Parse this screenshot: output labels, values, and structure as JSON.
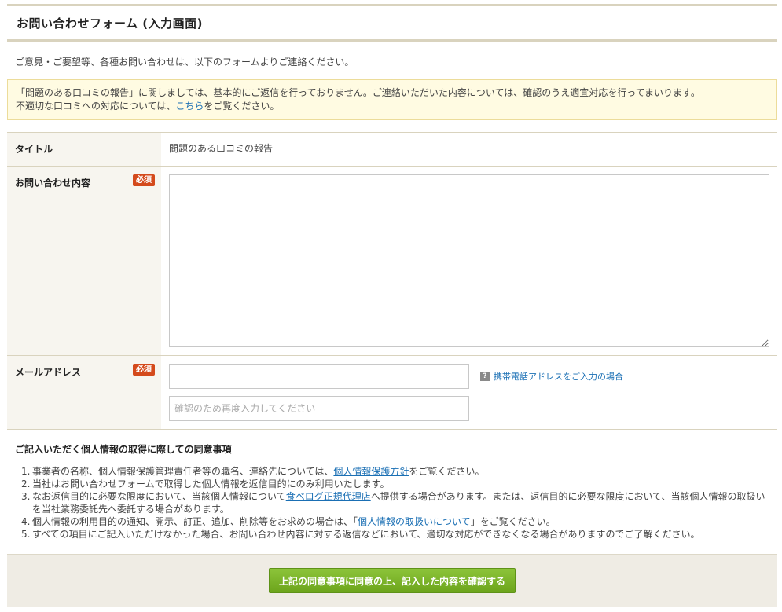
{
  "header": {
    "title": "お問い合わせフォーム (入力画面)"
  },
  "intro": "ご意見・ご要望等、各種お問い合わせは、以下のフォームよりご連絡ください。",
  "notice": {
    "line1": "「問題のある口コミの報告」に関しましては、基本的にご返信を行っておりません。ご連絡いただいた内容については、確認のうえ適宜対応を行ってまいります。",
    "line2_before": "不適切な口コミへの対応については、",
    "line2_link": "こちら",
    "line2_after": "をご覧ください。"
  },
  "form": {
    "required_badge": "必須",
    "title_label": "タイトル",
    "title_value": "問題のある口コミの報告",
    "content_label": "お問い合わせ内容",
    "content_value": "",
    "email_label": "メールアドレス",
    "email_value": "",
    "email_confirm_placeholder": "確認のため再度入力してください",
    "mobile_help_link": "携帯電話アドレスをご入力の場合"
  },
  "consent": {
    "heading": "ご記入いただく個人情報の取得に際しての同意事項",
    "items": [
      {
        "num": "1.",
        "before": "事業者の名称、個人情報保護管理責任者等の職名、連絡先については、",
        "link": "個人情報保護方針",
        "after": "をご覧ください。"
      },
      {
        "num": "2.",
        "text": "当社はお問い合わせフォームで取得した個人情報を返信目的にのみ利用いたします。"
      },
      {
        "num": "3.",
        "before": "なお返信目的に必要な限度において、当該個人情報について",
        "link": "食べログ正規代理店",
        "after": "へ提供する場合があります。または、返信目的に必要な限度において、当該個人情報の取扱いを当社業務委託先へ委託する場合があります。"
      },
      {
        "num": "4.",
        "before": "個人情報の利用目的の通知、開示、訂正、追加、削除等をお求めの場合は、「",
        "link": "個人情報の取扱いについて",
        "after": "」をご覧ください。"
      },
      {
        "num": "5.",
        "text": "すべての項目にご記入いただけなかった場合、お問い合わせ内容に対する返信などにおいて、適切な対応ができなくなる場合がありますのでご了解ください。"
      }
    ]
  },
  "footer": {
    "confirm_button": "上記の同意事項に同意の上、記入した内容を確認する"
  },
  "colors": {
    "accent_green": "#7ab42a",
    "required_red": "#d44a1c",
    "link_blue": "#1a6fb4",
    "notice_bg": "#fffbe2"
  },
  "icons": {
    "help": "question-icon"
  }
}
